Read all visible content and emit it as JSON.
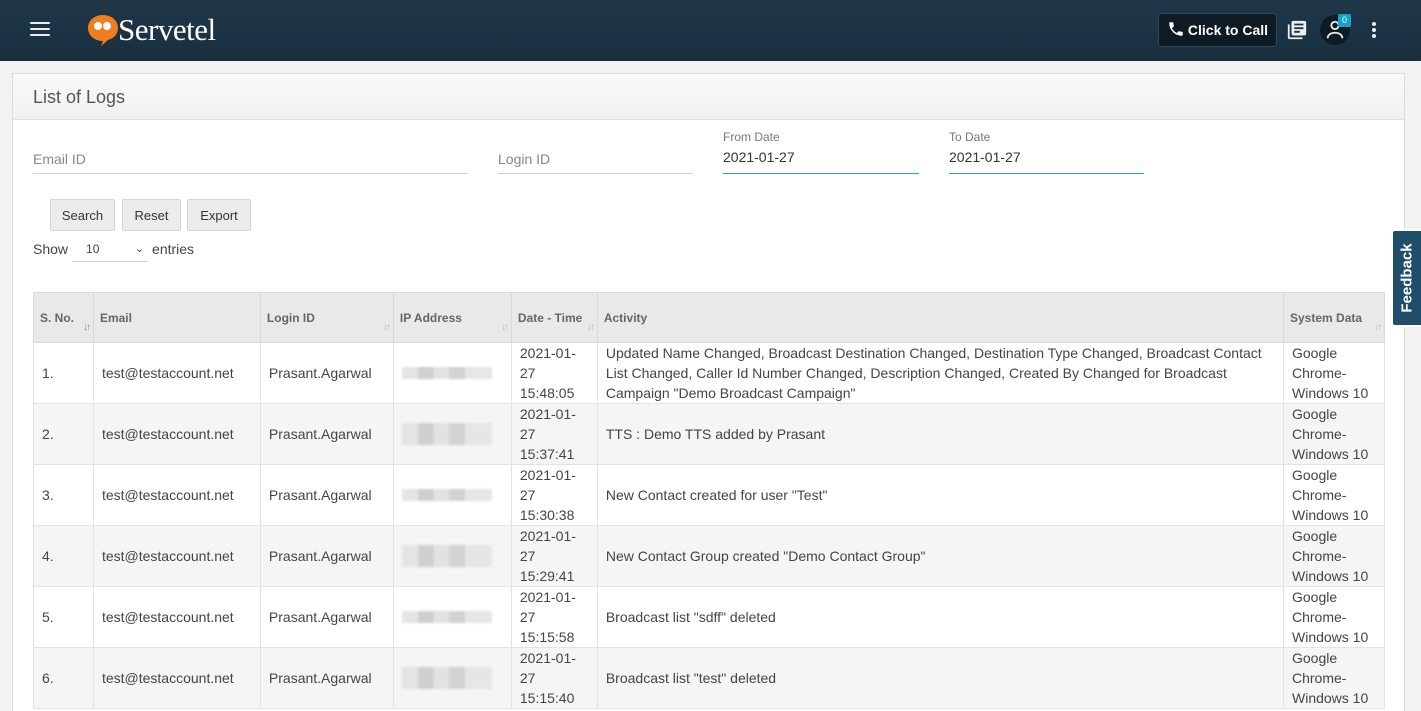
{
  "header": {
    "brand": "Servetel",
    "click_to_call": "Click to Call",
    "agent_badge": "0",
    "icons": [
      "menu-icon",
      "phone-icon",
      "book-icon",
      "agent-icon",
      "more-icon"
    ]
  },
  "page": {
    "title": "List of Logs"
  },
  "filters": {
    "email_placeholder": "Email ID",
    "login_placeholder": "Login ID",
    "from_label": "From Date",
    "from_value": "2021-01-27",
    "to_label": "To Date",
    "to_value": "2021-01-27"
  },
  "actions": {
    "search": "Search",
    "reset": "Reset",
    "export": "Export"
  },
  "length": {
    "show": "Show",
    "value": "10",
    "entries": "entries"
  },
  "table": {
    "headers": {
      "sno": "S. No.",
      "email": "Email",
      "login": "Login ID",
      "ip": "IP Address",
      "datetime": "Date - Time",
      "activity": "Activity",
      "system": "System Data"
    },
    "rows": [
      {
        "sno": "1.",
        "email": "test@testaccount.net",
        "login": "Prasant.Agarwal",
        "date": "2021-01-27 15:48:05",
        "activity": "Updated Name Changed, Broadcast Destination Changed, Destination Type Changed, Broadcast Contact List Changed, Caller Id Number Changed, Description Changed, Created By Changed for Broadcast Campaign \"Demo Broadcast Campaign\"",
        "system": "Google Chrome-Windows 10"
      },
      {
        "sno": "2.",
        "email": "test@testaccount.net",
        "login": "Prasant.Agarwal",
        "date": "2021-01-27 15:37:41",
        "activity": "TTS : Demo TTS added by Prasant",
        "system": "Google Chrome-Windows 10"
      },
      {
        "sno": "3.",
        "email": "test@testaccount.net",
        "login": "Prasant.Agarwal",
        "date": "2021-01-27 15:30:38",
        "activity": "New Contact created for user \"Test\"",
        "system": "Google Chrome-Windows 10"
      },
      {
        "sno": "4.",
        "email": "test@testaccount.net",
        "login": "Prasant.Agarwal",
        "date": "2021-01-27 15:29:41",
        "activity": "New Contact Group created \"Demo Contact Group\"",
        "system": "Google Chrome-Windows 10"
      },
      {
        "sno": "5.",
        "email": "test@testaccount.net",
        "login": "Prasant.Agarwal",
        "date": "2021-01-27 15:15:58",
        "activity": "Broadcast list \"sdff\" deleted",
        "system": "Google Chrome-Windows 10"
      },
      {
        "sno": "6.",
        "email": "test@testaccount.net",
        "login": "Prasant.Agarwal",
        "date": "2021-01-27 15:15:40",
        "activity": "Broadcast list \"test\" deleted",
        "system": "Google Chrome-Windows 10"
      }
    ]
  },
  "feedback": "Feedback",
  "colors": {
    "header_bg": "#1c3447",
    "accent": "#2aa0c8",
    "logo_orange": "#f07d1f"
  }
}
